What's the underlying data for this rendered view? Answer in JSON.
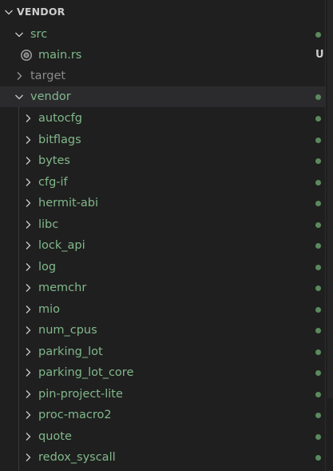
{
  "explorer": {
    "section_title": "VENDOR",
    "src": {
      "label": "src"
    },
    "main_rs": {
      "label": "main.rs",
      "status": "U"
    },
    "target": {
      "label": "target"
    },
    "vendor": {
      "label": "vendor"
    },
    "crates": [
      {
        "label": "autocfg"
      },
      {
        "label": "bitflags"
      },
      {
        "label": "bytes"
      },
      {
        "label": "cfg-if"
      },
      {
        "label": "hermit-abi"
      },
      {
        "label": "libc"
      },
      {
        "label": "lock_api"
      },
      {
        "label": "log"
      },
      {
        "label": "memchr"
      },
      {
        "label": "mio"
      },
      {
        "label": "num_cpus"
      },
      {
        "label": "parking_lot"
      },
      {
        "label": "parking_lot_core"
      },
      {
        "label": "pin-project-lite"
      },
      {
        "label": "proc-macro2"
      },
      {
        "label": "quote"
      },
      {
        "label": "redox_syscall"
      }
    ]
  },
  "icons": {
    "chevron_down": "chevron-down-icon",
    "chevron_right": "chevron-right-icon",
    "rust_file": "rust-file-icon"
  },
  "colors": {
    "background": "#1f1f1f",
    "selected_row": "#2b2b2e",
    "untracked_text": "#81b88b",
    "ignored_text": "#8b8b8b",
    "modified_dot": "#5a8a5e"
  }
}
